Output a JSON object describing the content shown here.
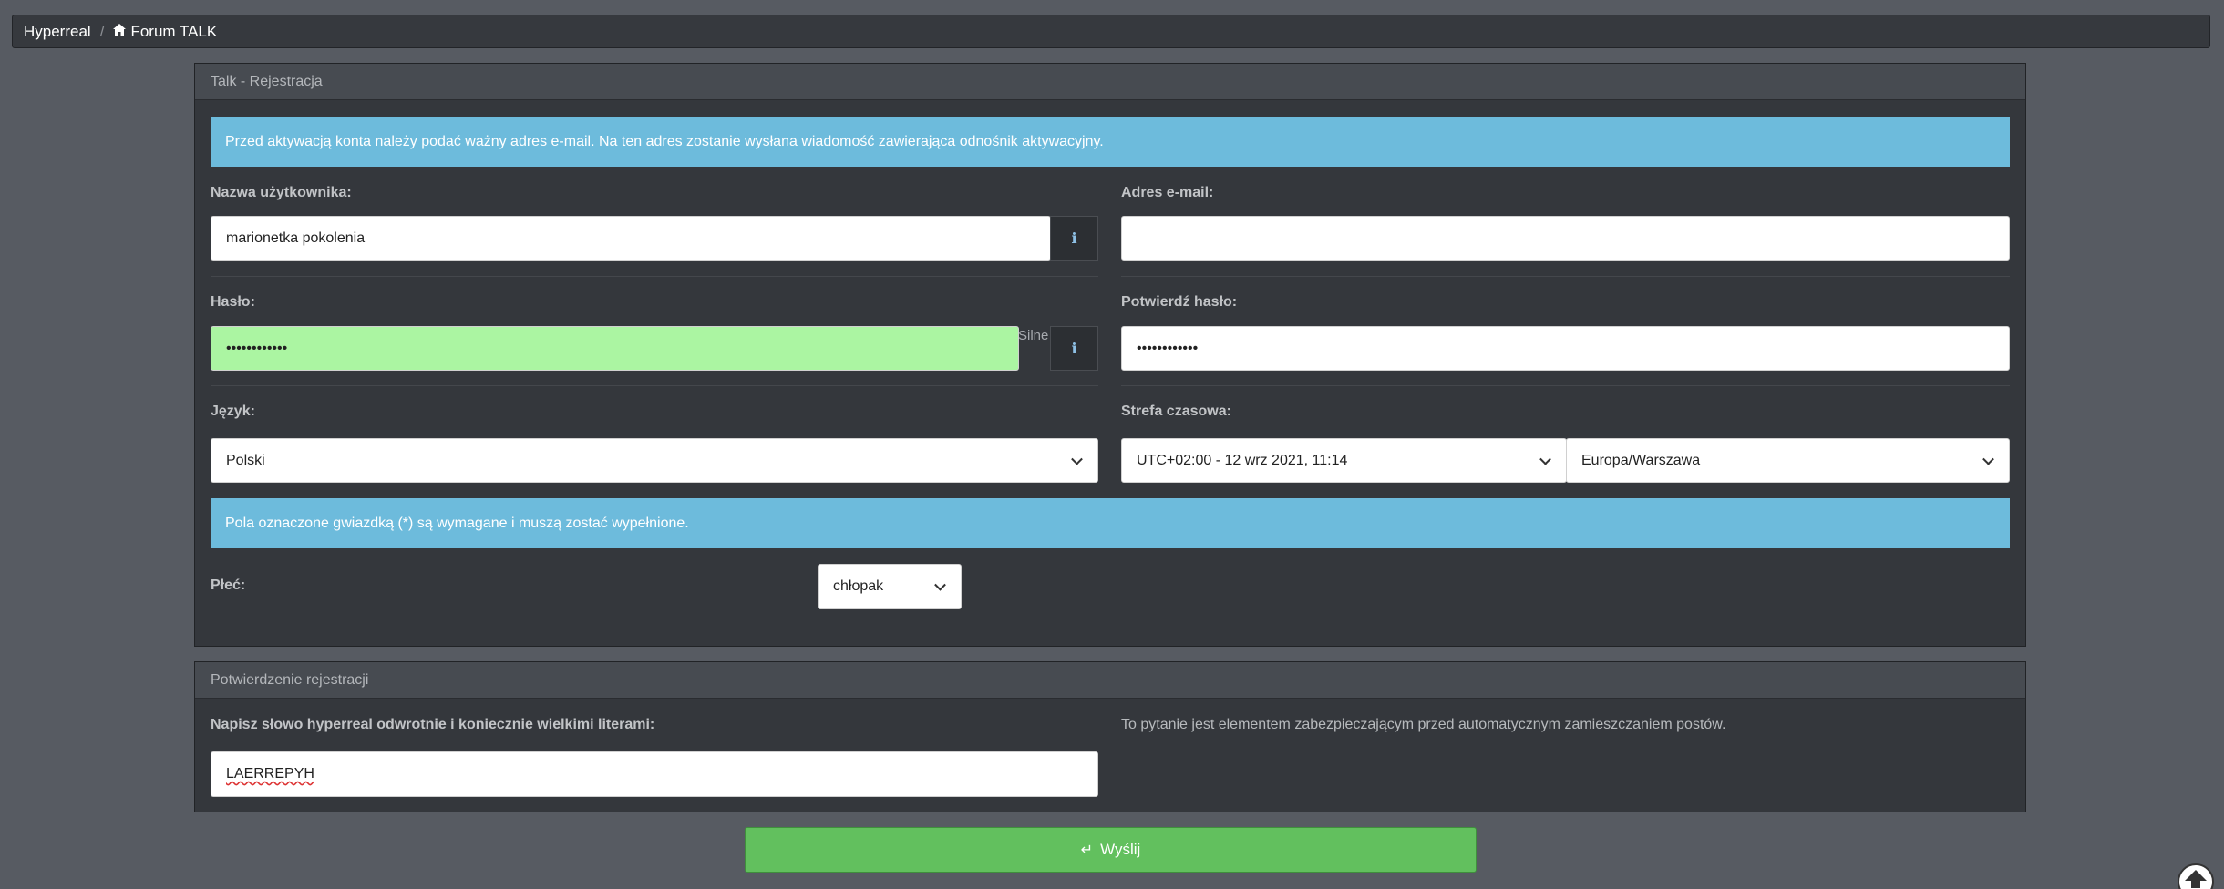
{
  "breadcrumb": {
    "root": "Hyperreal",
    "separator": "/",
    "home_icon": "home-icon",
    "current": "Forum TALK"
  },
  "registration": {
    "panel_title": "Talk - Rejestracja",
    "info_alert": "Przed aktywacją konta należy podać ważny adres e-mail. Na ten adres zostanie wysłana wiadomość zawierająca odnośnik aktywacyjny.",
    "username": {
      "label": "Nazwa użytkownika:",
      "value": "marionetka pokolenia",
      "info_icon": "i"
    },
    "email": {
      "label": "Adres e-mail:",
      "value": ""
    },
    "password": {
      "label": "Hasło:",
      "value": "••••••••••••",
      "strength": "Silne",
      "info_icon": "i",
      "strength_color": "#abf5a2"
    },
    "password_confirm": {
      "label": "Potwierdź hasło:",
      "value": "••••••••••••"
    },
    "language": {
      "label": "Język:",
      "selected": "Polski"
    },
    "timezone": {
      "label": "Strefa czasowa:",
      "offset_selected": "UTC+02:00 - 12 wrz 2021, 11:14",
      "zone_selected": "Europa/Warszawa"
    },
    "required_alert": "Pola oznaczone gwiazdką (*) są wymagane i muszą zostać wypełnione.",
    "gender": {
      "label": "Płeć:",
      "selected": "chłopak"
    }
  },
  "confirmation": {
    "panel_title": "Potwierdzenie rejestracji",
    "question_label": "Napisz słowo hyperreal odwrotnie i koniecznie wielkimi literami:",
    "answer_value": "LAERREPYH",
    "explanation": "To pytanie jest elementem zabezpieczającym przed automatycznym zamieszczaniem postów."
  },
  "submit": {
    "icon": "↵",
    "label": "Wyślij",
    "color": "#62c05e"
  },
  "scroll_top_icon": "arrow-up-circle-icon"
}
